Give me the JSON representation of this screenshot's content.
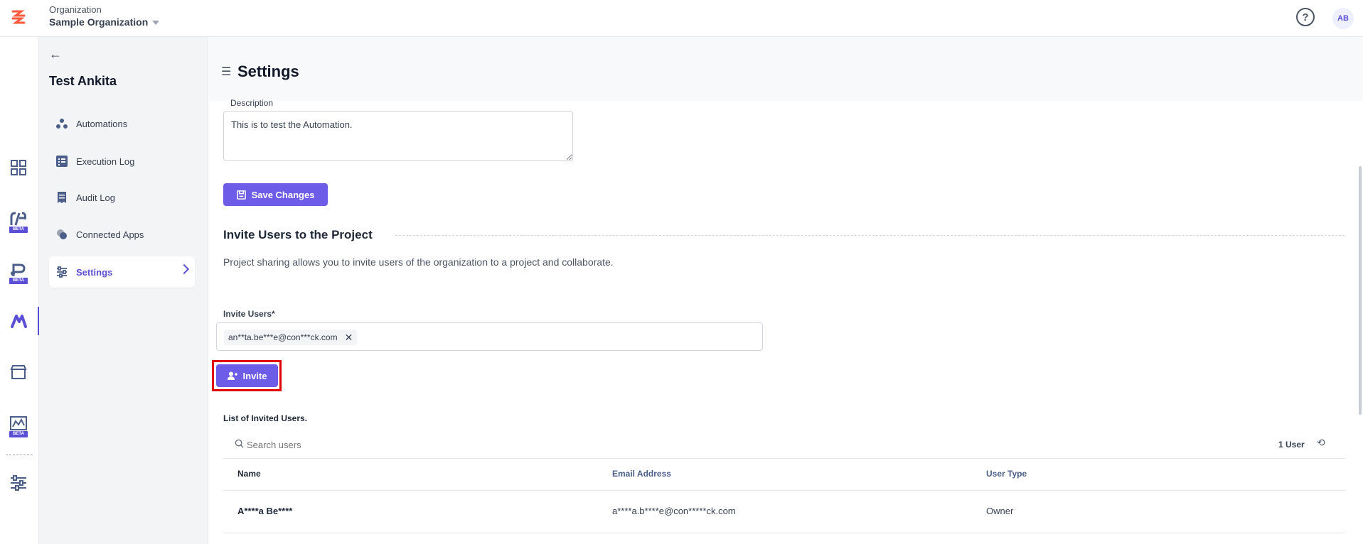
{
  "topbar": {
    "org_label": "Organization",
    "org_name": "Sample Organization",
    "help_icon": "question-circle-icon",
    "avatar_initials": "AB"
  },
  "rail": {
    "items": [
      {
        "icon": "grid-icon"
      },
      {
        "icon": "rf-beta-icon",
        "badge": "BETA"
      },
      {
        "icon": "p-beta-icon",
        "badge": "BETA"
      },
      {
        "icon": "automation-icon"
      },
      {
        "icon": "store-icon"
      },
      {
        "icon": "chart-beta-icon",
        "badge": "BETA"
      },
      {
        "icon": "sliders-icon"
      }
    ]
  },
  "sidenav": {
    "project_title": "Test Ankita",
    "items": [
      {
        "label": "Automations",
        "icon": "automations-icon"
      },
      {
        "label": "Execution Log",
        "icon": "list-icon"
      },
      {
        "label": "Audit Log",
        "icon": "receipt-icon"
      },
      {
        "label": "Connected Apps",
        "icon": "connected-apps-icon"
      },
      {
        "label": "Settings",
        "icon": "settings-sliders-icon",
        "active": true
      }
    ]
  },
  "main": {
    "title": "Settings",
    "description_label": "Description",
    "description_value": "This is to test the Automation.",
    "save_label": "Save Changes",
    "section_title": "Invite Users to the Project",
    "section_desc": "Project sharing allows you to invite users of the organization to a project and collaborate.",
    "invite_label": "Invite Users*",
    "invite_chip": "an**ta.be***e@con***ck.com",
    "invite_button": "Invite",
    "list_label": "List of Invited Users.",
    "search_placeholder": "Search users",
    "user_count": "1 User",
    "table": {
      "headers": [
        "Name",
        "Email Address",
        "User Type"
      ],
      "rows": [
        [
          "A****a Be****",
          "a****a.b****e@con*****ck.com",
          "Owner"
        ]
      ]
    }
  },
  "colors": {
    "accent": "#6c5ce7",
    "highlight": "#e00000",
    "header_link": "#4b5e8a"
  }
}
